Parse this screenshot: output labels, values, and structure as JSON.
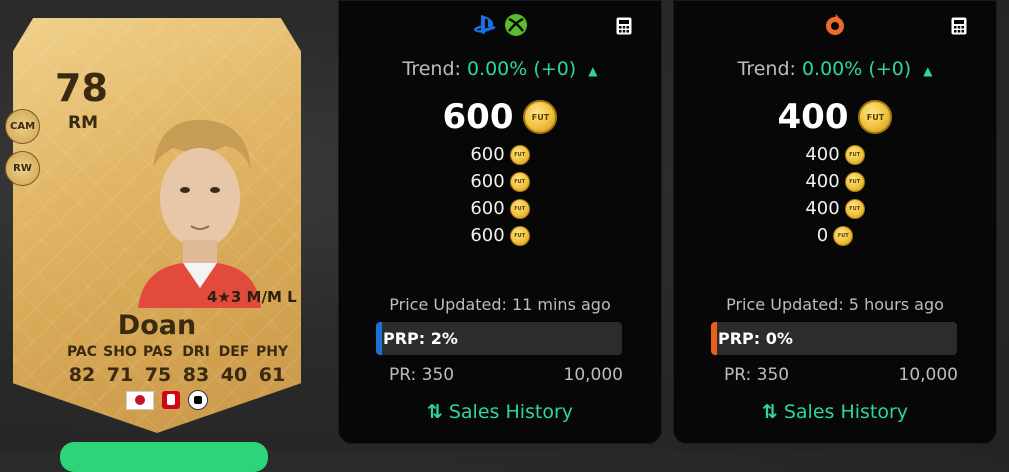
{
  "card": {
    "rating": "78",
    "position": "RM",
    "alt_positions": [
      "CAM",
      "RW"
    ],
    "skills": "4★3 M/M L",
    "name": "Doan",
    "stat_labels": [
      "PAC",
      "SHO",
      "PAS",
      "DRI",
      "DEF",
      "PHY"
    ],
    "stat_values": [
      "82",
      "71",
      "75",
      "83",
      "40",
      "61"
    ]
  },
  "panels": [
    {
      "platform_icons": [
        "playstation-icon",
        "xbox-icon"
      ],
      "trend_label": "Trend:",
      "trend_value": "0.00% (+0)",
      "trend_arrow": "▲",
      "price": "600",
      "prices": [
        "600",
        "600",
        "600",
        "600"
      ],
      "updated": "Price Updated: 11 mins ago",
      "prp": "PRP: 2%",
      "prp_value": 0.02,
      "pr_min": "PR: 350",
      "pr_max": "10,000",
      "sales": "Sales History",
      "accent": "#1d6fd8"
    },
    {
      "platform_icons": [
        "origin-icon"
      ],
      "trend_label": "Trend:",
      "trend_value": "0.00% (+0)",
      "trend_arrow": "▲",
      "price": "400",
      "prices": [
        "400",
        "400",
        "400",
        "0"
      ],
      "updated": "Price Updated: 5 hours ago",
      "prp": "PRP: 0%",
      "prp_value": 0.0,
      "pr_min": "PR: 350",
      "pr_max": "10,000",
      "sales": "Sales History",
      "accent": "#e8601c"
    }
  ],
  "coin_label": "FUT",
  "colors": {
    "trend": "#2ed4a2",
    "card_gold": "#e2b868"
  }
}
